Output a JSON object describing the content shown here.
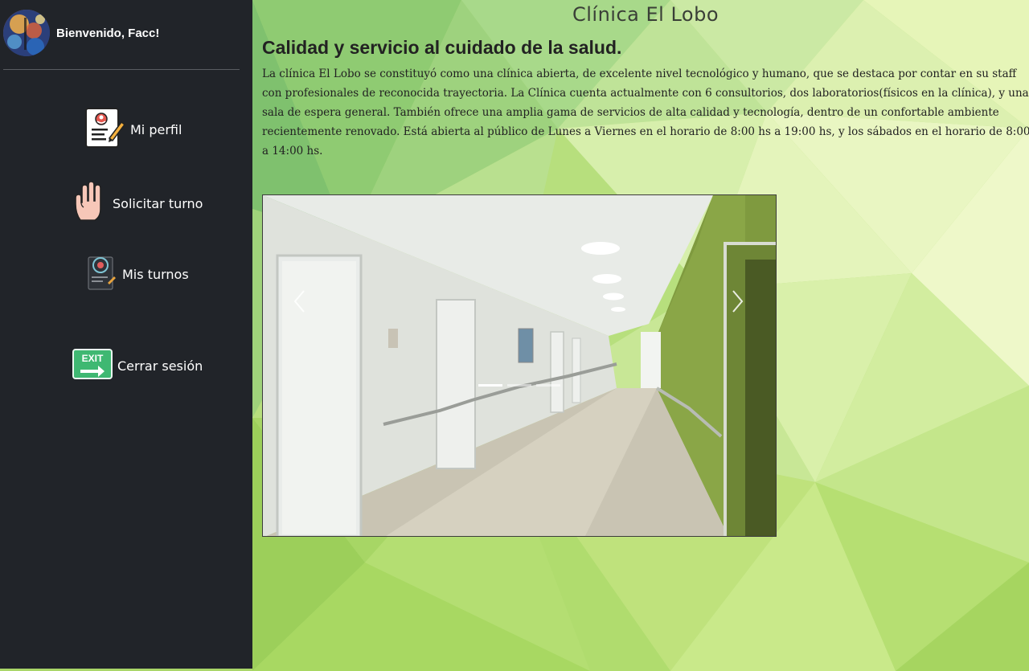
{
  "sidebar": {
    "welcome": "Bienvenido, Facc!",
    "items": [
      {
        "label": "Mi perfil",
        "icon": "profile-card-icon"
      },
      {
        "label": "Solicitar turno",
        "icon": "raised-hand-icon"
      },
      {
        "label": "Mis turnos",
        "icon": "appointments-document-icon"
      },
      {
        "label": "Cerrar sesión",
        "icon": "exit-sign-icon"
      }
    ],
    "exit_sign_text": "EXIT"
  },
  "main": {
    "site_title": "Clínica El Lobo",
    "headline": "Calidad y servicio al cuidado de la salud.",
    "intro": "La clínica El Lobo se constituyó como una clínica abierta, de excelente nivel tecnológico y humano, que se destaca por contar en su staff con profesionales de reconocida trayectoria. La Clínica cuenta actualmente con 6 consultorios, dos laboratorios(físicos en la clínica), y una sala de espera general. También ofrece una amplia gama de servicios de alta calidad y tecnología, dentro de un confortable ambiente recientemente renovado. Está abierta al público de Lunes a Viernes en el horario de 8:00 hs a 19:00 hs, y los sábados en el horario de 8:00 a 14:00 hs.",
    "carousel": {
      "slide_count": 3,
      "active_slide": 1,
      "prev_icon": "chevron-left-icon",
      "next_icon": "chevron-right-icon"
    }
  },
  "colors": {
    "sidebar_bg": "#212429",
    "main_bg_green": "#a9d668",
    "text_dark": "#222222"
  }
}
